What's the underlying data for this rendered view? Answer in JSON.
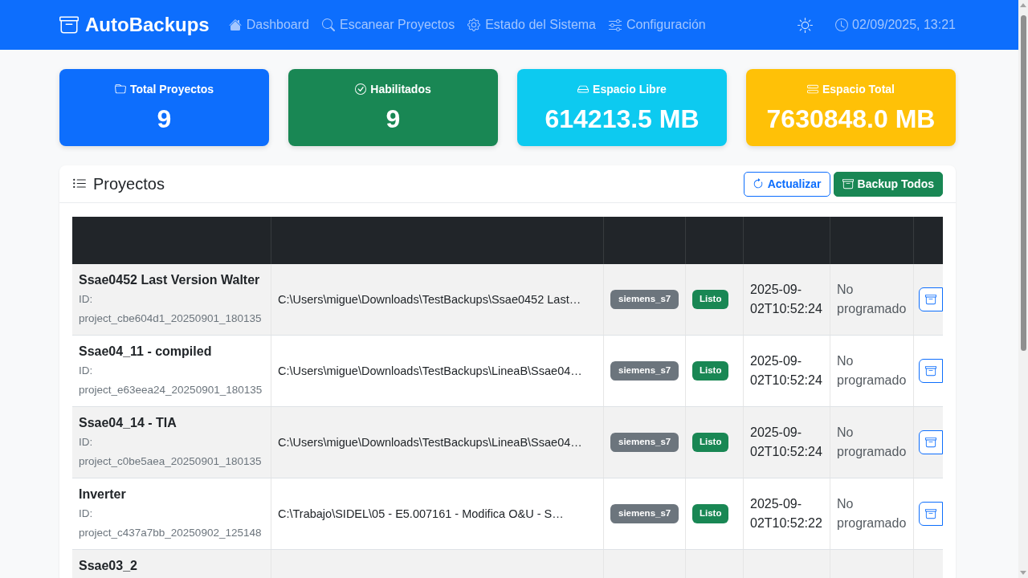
{
  "navbar": {
    "brand": "AutoBackups",
    "links": [
      "Dashboard",
      "Escanear Proyectos",
      "Estado del Sistema",
      "Configuración"
    ],
    "datetime": "02/09/2025, 13:21"
  },
  "stats": [
    {
      "label": "Total Proyectos",
      "value": "9",
      "color": "#0d6efd"
    },
    {
      "label": "Habilitados",
      "value": "9",
      "color": "#198754"
    },
    {
      "label": "Espacio Libre",
      "value": "614213.5 MB",
      "color": "#0dcaf0"
    },
    {
      "label": "Espacio Total",
      "value": "7630848.0 MB",
      "color": "#ffc107"
    }
  ],
  "projects_panel": {
    "title": "Proyectos",
    "buttons": [
      {
        "label": "Actualizar",
        "kind": "outline"
      },
      {
        "label": "Backup Todos",
        "kind": "solid"
      }
    ],
    "table": {
      "rows": [
        {
          "name": "Ssae0452 Last Version Walter",
          "id": "ID: project_cbe604d1_20250901_180135",
          "path": "C:\\Users\\migue\\Downloads\\TestBackups\\Ssae0452 Last…",
          "type": "siemens_s7",
          "status": "Listo",
          "last_backup": "2025-09-02T10:52:24",
          "schedule": "No programado"
        },
        {
          "name": "Ssae04_11 - compiled",
          "id": "ID: project_e63eea24_20250901_180135",
          "path": "C:\\Users\\migue\\Downloads\\TestBackups\\LineaB\\Ssae04…",
          "type": "siemens_s7",
          "status": "Listo",
          "last_backup": "2025-09-02T10:52:24",
          "schedule": "No programado"
        },
        {
          "name": "Ssae04_14 - TIA",
          "id": "ID: project_c0be5aea_20250901_180135",
          "path": "C:\\Users\\migue\\Downloads\\TestBackups\\LineaB\\Ssae04…",
          "type": "siemens_s7",
          "status": "Listo",
          "last_backup": "2025-09-02T10:52:24",
          "schedule": "No programado"
        },
        {
          "name": "Inverter",
          "id": "ID: project_c437a7bb_20250902_125148",
          "path": "C:\\Trabajo\\SIDEL\\05 - E5.007161 - Modifica O&U - S…",
          "type": "siemens_s7",
          "status": "Listo",
          "last_backup": "2025-09-02T10:52:22",
          "schedule": "No programado"
        },
        {
          "name": "Ssae03_2"
        }
      ]
    }
  }
}
